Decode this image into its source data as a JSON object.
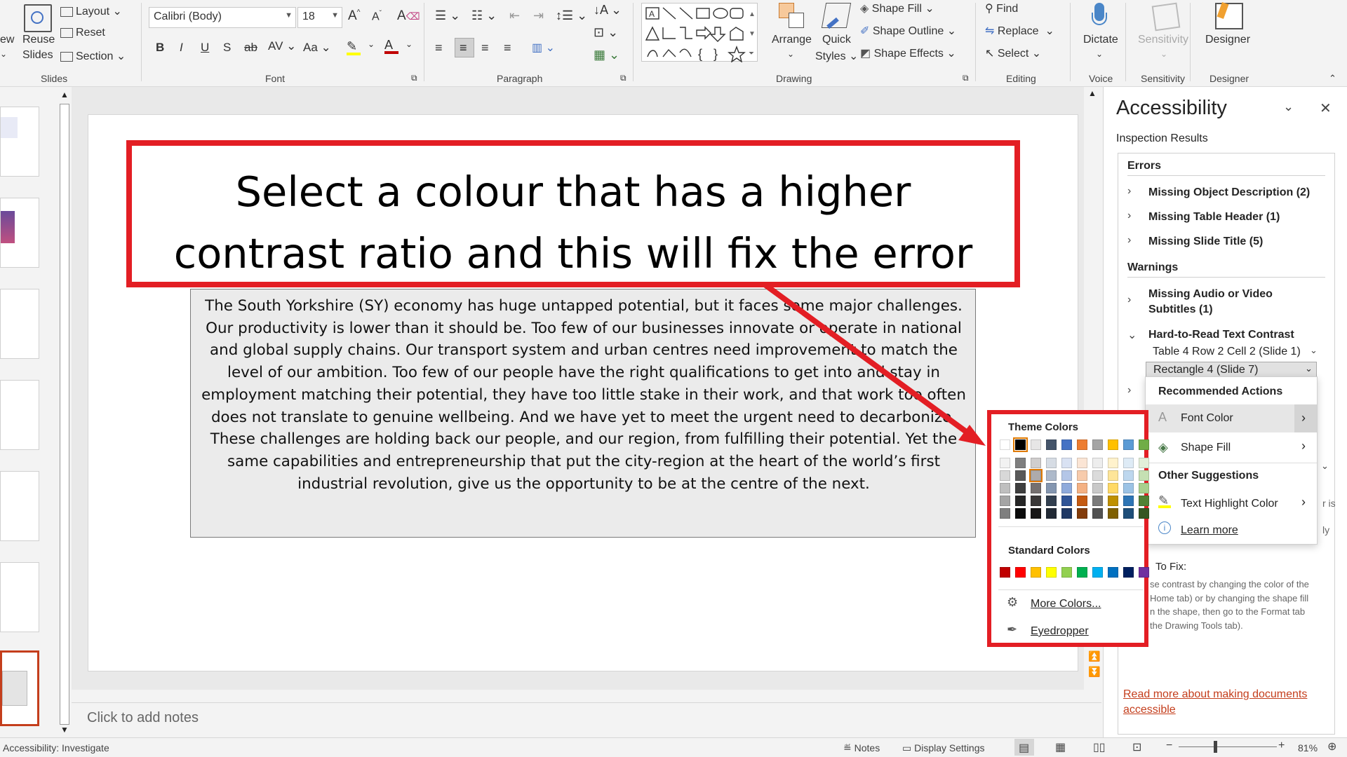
{
  "ribbon": {
    "slides_group": {
      "label": "Slides",
      "new": "ew",
      "reuse": "Reuse",
      "reuse2": "Slides",
      "layout": "Layout",
      "reset": "Reset",
      "section": "Section"
    },
    "font_group": {
      "label": "Font",
      "font_name": "Calibri (Body)",
      "font_size": "18"
    },
    "paragraph_group": {
      "label": "Paragraph"
    },
    "drawing_group": {
      "label": "Drawing",
      "arrange": "Arrange",
      "quick": "Quick",
      "styles": "Styles",
      "shape_fill": "Shape Fill",
      "shape_outline": "Shape Outline",
      "shape_effects": "Shape Effects"
    },
    "editing_group": {
      "label": "Editing",
      "find": "Find",
      "replace": "Replace",
      "select": "Select"
    },
    "voice_group": {
      "label": "Voice",
      "dictate": "Dictate"
    },
    "sensitivity_group": {
      "label": "Sensitivity",
      "sensitivity": "Sensitivity"
    },
    "designer_group": {
      "label": "Designer",
      "designer": "Designer"
    }
  },
  "slide": {
    "body_lines": [
      "The South Yorkshire (SY) economy has huge untapped potential, but it faces some major challenges.",
      "Our productivity is lower than it should be. Too few of our businesses innovate or operate in national",
      "and global supply chains. Our transport system and urban centres need improvement to match the",
      "level of our ambition. Too few of our people have the right qualifications to get into and stay in",
      "employment matching their potential, they have too little stake in their work, and that work too often",
      "does not translate to genuine wellbeing. And we have yet to meet the urgent need to decarbonize.",
      "These challenges are holding back our people, and our region, from fulfilling their potential. Yet the",
      "same capabilities and entrepreneurship that put the city-region at the heart of the world’s first",
      "industrial revolution, give us the opportunity to be at the centre of the next."
    ]
  },
  "callout": {
    "line1": "Select a colour that has a higher",
    "line2": "contrast ratio and this will fix the error"
  },
  "notes": {
    "placeholder": "Click to add notes"
  },
  "accessibility_pane": {
    "title": "Accessibility",
    "inspection": "Inspection Results",
    "errors_heading": "Errors",
    "errors": [
      "Missing Object Description (2)",
      "Missing Table Header (1)",
      "Missing Slide Title (5)"
    ],
    "warnings_heading": "Warnings",
    "warnings_av_1": "Missing Audio or Video",
    "warnings_av_2": "Subtitles (1)",
    "contrast": "Hard-to-Read Text Contrast",
    "contrast_item1": "Table 4 Row 2 Cell 2 (Slide 1)",
    "contrast_item2": "Rectangle 4  (Slide 7)",
    "partial_right1": "r is",
    "partial_right2": "ly",
    "howto_heading": "To Fix:",
    "howto_lines": [
      "se contrast by changing the color of the",
      "Home tab) or by changing the shape fill",
      "n the shape, then go to the Format tab",
      "the Drawing Tools tab)."
    ],
    "readmore_1": "Read more about making documents",
    "readmore_2": "accessible"
  },
  "submenu": {
    "recommended": "Recommended Actions",
    "font_color": "Font Color",
    "shape_fill": "Shape Fill",
    "other": "Other Suggestions",
    "highlight": "Text Highlight Color",
    "learn": "Learn more"
  },
  "palette": {
    "theme_heading": "Theme Colors",
    "standard_heading": "Standard Colors",
    "more_colors": "More Colors...",
    "eyedropper": "Eyedropper",
    "theme_top": [
      "#ffffff",
      "#000000",
      "#e7e6e6",
      "#44546a",
      "#4472c4",
      "#ed7d31",
      "#a5a5a5",
      "#ffc000",
      "#5b9bd5",
      "#70ad47"
    ],
    "theme_shades": [
      [
        "#f2f2f2",
        "#7f7f7f",
        "#d0cece",
        "#d6dce4",
        "#d9e2f3",
        "#fbe5d5",
        "#ededed",
        "#fff2cc",
        "#deebf6",
        "#e2efd9"
      ],
      [
        "#d8d8d8",
        "#595959",
        "#aeabab",
        "#adb9ca",
        "#b4c6e7",
        "#f7cbac",
        "#dbdbdb",
        "#fee599",
        "#bdd7ee",
        "#c5e0b3"
      ],
      [
        "#bfbfbf",
        "#3f3f3f",
        "#757070",
        "#8496b0",
        "#8eaadb",
        "#f4b183",
        "#c9c9c9",
        "#ffd965",
        "#9cc3e5",
        "#a8d08d"
      ],
      [
        "#a5a5a5",
        "#262626",
        "#3a3838",
        "#323f4f",
        "#2f5496",
        "#c55a11",
        "#7b7b7b",
        "#bf9000",
        "#2e75b5",
        "#538135"
      ],
      [
        "#7f7f7f",
        "#0c0c0c",
        "#171616",
        "#222a35",
        "#1f3864",
        "#833c0b",
        "#525252",
        "#7f6000",
        "#1e4e79",
        "#375623"
      ]
    ],
    "standard": [
      "#c00000",
      "#ff0000",
      "#ffc000",
      "#ffff00",
      "#92d050",
      "#00b050",
      "#00b0f0",
      "#0070c0",
      "#002060",
      "#7030a0"
    ]
  },
  "statusbar": {
    "left": "Accessibility: Investigate",
    "notes": "Notes",
    "display": "Display Settings",
    "zoom": "81%"
  }
}
